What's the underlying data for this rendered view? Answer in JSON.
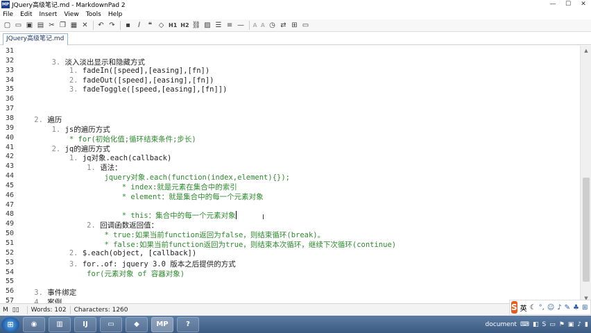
{
  "window": {
    "title": "JQuery高级笔记.md - MarkdownPad 2",
    "app_icon": "MP",
    "controls": [
      "—",
      "☐",
      "✕"
    ]
  },
  "menu": [
    "File",
    "Edit",
    "Insert",
    "View",
    "Tools",
    "Help"
  ],
  "toolbar": {
    "h1": "H1",
    "h2": "H2",
    "a_large": "A",
    "a_small": "A"
  },
  "tab": {
    "label": "JQuery高级笔记.md"
  },
  "editor": {
    "line_numbers": [
      "31",
      "32",
      "33",
      "34",
      "35",
      "36",
      "37",
      "38",
      "39",
      "40",
      "41",
      "42",
      "43",
      "44",
      "45",
      "46",
      "47",
      "48",
      "49",
      "50",
      "51",
      "52",
      "53",
      "54",
      "55",
      "56",
      "57"
    ],
    "lines": [
      {
        "m": "",
        "t": "",
        "g": ""
      },
      {
        "m": "        3. ",
        "t": "淡入淡出显示和隐藏方式",
        "g": ""
      },
      {
        "m": "            1. ",
        "t": "fadeIn([speed],[easing],[fn])",
        "g": ""
      },
      {
        "m": "            2. ",
        "t": "fadeOut([speed],[easing],[fn])",
        "g": ""
      },
      {
        "m": "            3. ",
        "t": "fadeToggle([speed,[easing],[fn]])",
        "g": ""
      },
      {
        "m": "",
        "t": "",
        "g": ""
      },
      {
        "m": "",
        "t": "",
        "g": ""
      },
      {
        "m": "    2. ",
        "t": "遍历",
        "g": ""
      },
      {
        "m": "        1. ",
        "t": "js的遍历方式",
        "g": ""
      },
      {
        "m": "            ",
        "t": "",
        "g": "* for(初始化值;循环结束条件;步长)"
      },
      {
        "m": "        2. ",
        "t": "jq的遍历方式",
        "g": ""
      },
      {
        "m": "            1. ",
        "t": "jq对象.each(callback)",
        "g": ""
      },
      {
        "m": "                1. ",
        "t": "语法：",
        "g": ""
      },
      {
        "m": "                    ",
        "t": "",
        "g": "jquery对象.each(function(index,element){});"
      },
      {
        "m": "                        ",
        "t": "",
        "g": "* index:就是元素在集合中的索引"
      },
      {
        "m": "                        ",
        "t": "",
        "g": "* element：就是集合中的每一个元素对象"
      },
      {
        "m": "",
        "t": "",
        "g": ""
      },
      {
        "m": "                        ",
        "t": "",
        "g": "* this：集合中的每一个元素对象"
      },
      {
        "m": "                2. ",
        "t": "回调函数返回值：",
        "g": ""
      },
      {
        "m": "                    ",
        "t": "",
        "g": "* true:如果当前function返回为false，则结束循环(break)。"
      },
      {
        "m": "                    ",
        "t": "",
        "g": "* false:如果当前function返回为true，则结束本次循环，继续下次循环(continue)"
      },
      {
        "m": "            2. ",
        "t": "$.each(object, [callback])",
        "g": ""
      },
      {
        "m": "            3. ",
        "t": "for..of: jquery 3.0 版本之后提供的方式",
        "g": ""
      },
      {
        "m": "                ",
        "t": "",
        "g": "for(元素对象 of 容器对象)"
      },
      {
        "m": "",
        "t": "",
        "g": ""
      },
      {
        "m": "    3. ",
        "t": "事件绑定",
        "g": ""
      },
      {
        "m": "    4. ",
        "t": "案例",
        "g": ""
      }
    ],
    "caret_line_index": 17
  },
  "status": {
    "words": "Words: 102",
    "characters": "Characters: 1260"
  },
  "ime": {
    "logo": "S",
    "mode": "英"
  },
  "taskbar": {
    "apps": [
      "IJ",
      "MP",
      "?"
    ],
    "tray_label": "document"
  },
  "colors": {
    "list_marker": "#8a8a8a",
    "code_green": "#2e8b2e",
    "tab_border": "#9db6d3",
    "taskbar": "#4a6b94",
    "ime_logo": "#e85a1e"
  }
}
